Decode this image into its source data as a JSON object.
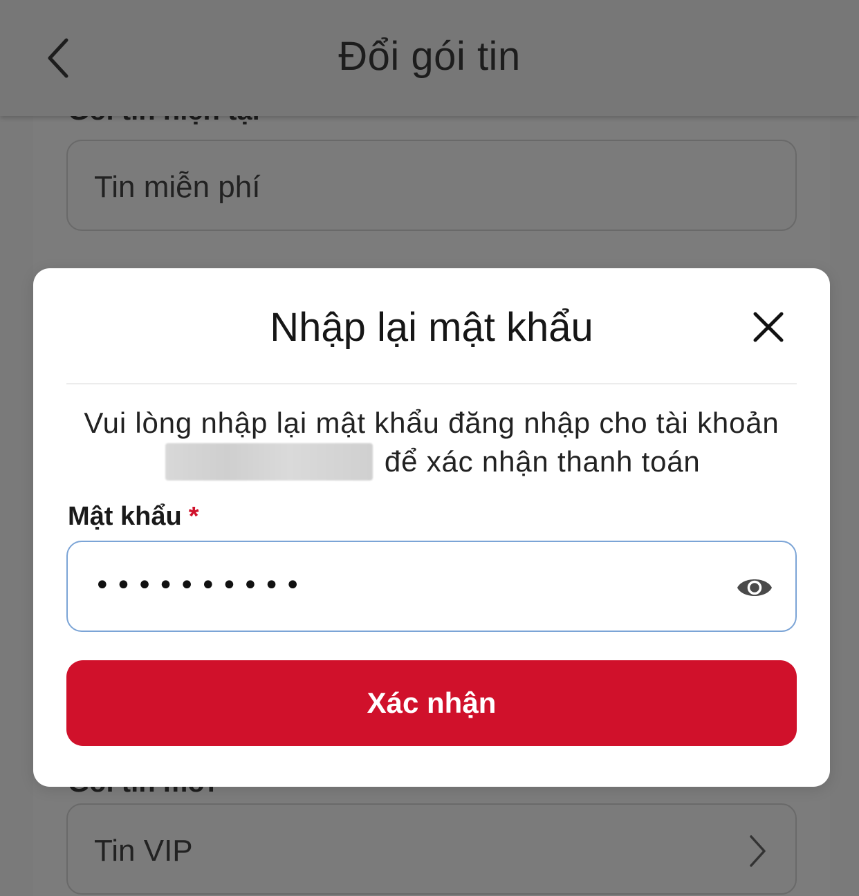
{
  "header": {
    "title": "Đổi gói tin",
    "back_icon": "chevron-left-icon"
  },
  "current_package": {
    "label": "Gói tin hiện tại",
    "value": "Tin miễn phí"
  },
  "new_package": {
    "label": "Gói tin mới",
    "value": "Tin VIP",
    "chevron_icon": "chevron-right-icon"
  },
  "modal": {
    "title": "Nhập lại mật khẩu",
    "close_icon": "close-icon",
    "message_before": "Vui lòng nhập lại mật khẩu đăng nhập cho tài khoản",
    "message_after": "để xác nhận thanh toán",
    "password_label": "Mật khẩu",
    "required_mark": "*",
    "password_value": "••••••••••",
    "eye_icon": "eye-icon",
    "confirm_label": "Xác nhận"
  },
  "colors": {
    "accent": "#d0112b",
    "overlay": "#7a7a7a",
    "input_focus_border": "#7ba4d6"
  }
}
